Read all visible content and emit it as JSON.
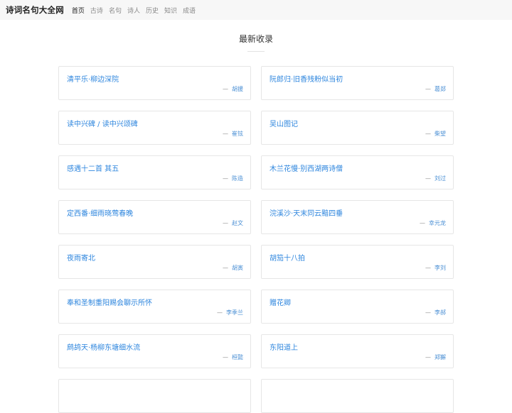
{
  "header": {
    "brand": "诗词名句大全网",
    "nav": [
      {
        "label": "首页",
        "active": true
      },
      {
        "label": "古诗",
        "active": false
      },
      {
        "label": "名句",
        "active": false
      },
      {
        "label": "诗人",
        "active": false
      },
      {
        "label": "历史",
        "active": false
      },
      {
        "label": "知识",
        "active": false
      },
      {
        "label": "成语",
        "active": false
      }
    ]
  },
  "main": {
    "section_title": "最新收录",
    "dash": "—",
    "poems": [
      {
        "title": "清平乐·柳边深院",
        "author": "胡援"
      },
      {
        "title": "阮郎归·旧香残粉似当初",
        "author": "葛郯"
      },
      {
        "title": "读中兴碑 / 读中兴颂碑",
        "author": "崔铉"
      },
      {
        "title": "吴山图记",
        "author": "柴望"
      },
      {
        "title": "感遇十二首 其五",
        "author": "陈造"
      },
      {
        "title": "木兰花慢·别西湖两诗僧",
        "author": "刘过"
      },
      {
        "title": "定西番·细雨晓莺春晚",
        "author": "赵文"
      },
      {
        "title": "浣溪沙·天末同云黯四垂",
        "author": "幸元龙"
      },
      {
        "title": "夜雨寄北",
        "author": "胡寅"
      },
      {
        "title": "胡笳十八拍",
        "author": "李刘"
      },
      {
        "title": "奉和圣制重阳赐会聊示所怀",
        "author": "李季兰"
      },
      {
        "title": "赠花卿",
        "author": "李郝"
      },
      {
        "title": "鹧鸪天·杨柳东塘细水流",
        "author": "桓懿"
      },
      {
        "title": "东阳道上",
        "author": "郑獬"
      },
      {
        "title": "",
        "author": ""
      },
      {
        "title": "",
        "author": ""
      }
    ]
  }
}
